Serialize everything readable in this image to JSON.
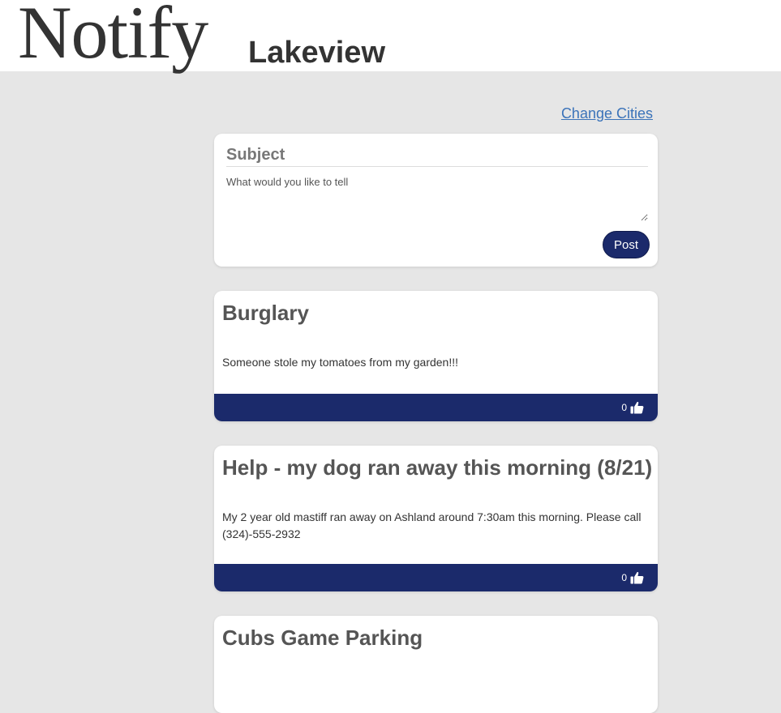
{
  "header": {
    "logo": "Notify",
    "city": "Lakeview"
  },
  "nav": {
    "change_cities": "Change Cities"
  },
  "compose": {
    "subject_placeholder": "Subject",
    "body_placeholder": "What would you like to tell",
    "post_label": "Post"
  },
  "posts": [
    {
      "title": "Burglary",
      "body": "Someone stole my tomatoes from my garden!!!",
      "likes": "0"
    },
    {
      "title": "Help - my dog ran away this morning (8/21)",
      "body": "My 2 year old mastiff ran away on Ashland around 7:30am this morning. Please call (324)-555-2932",
      "likes": "0"
    },
    {
      "title": "Cubs Game Parking",
      "body": "",
      "likes": ""
    }
  ],
  "icons": {
    "like": "thumbs-up-icon"
  },
  "colors": {
    "accent": "#1b2a6b",
    "link": "#3b73b9",
    "background": "#e6e6e6"
  }
}
